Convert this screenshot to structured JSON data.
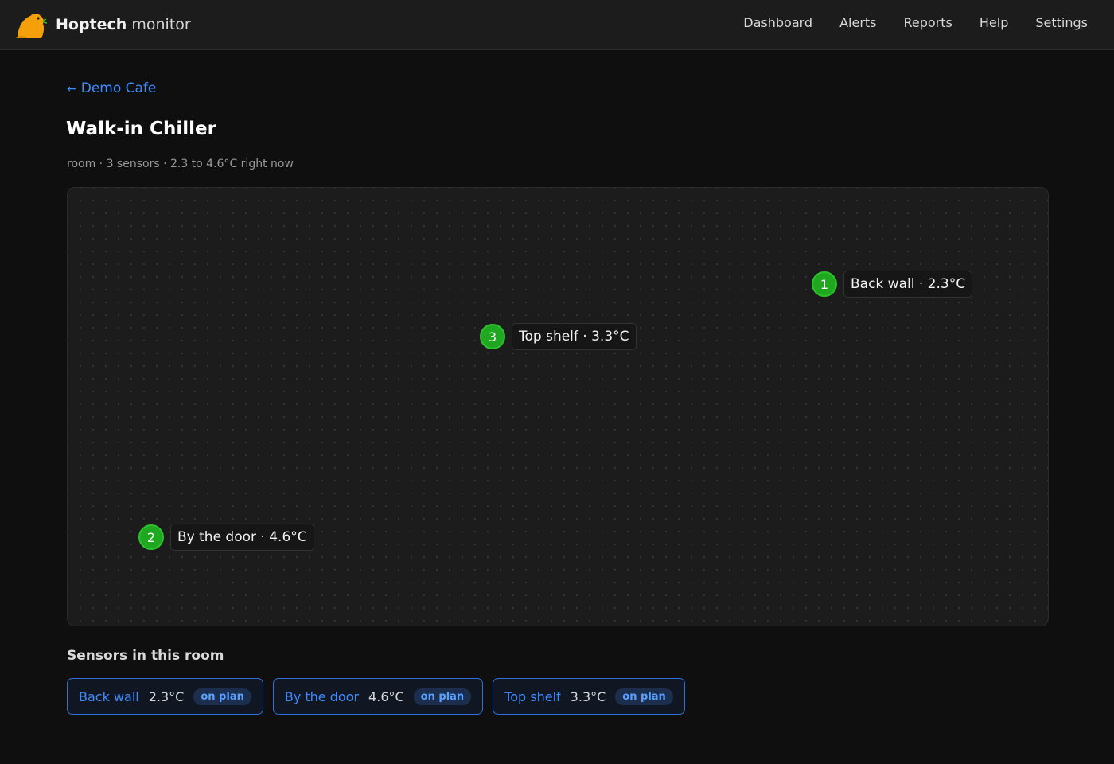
{
  "header": {
    "brand_bold": "Hoptech",
    "brand_light": "monitor",
    "logo_icon": "beaver-icon",
    "nav": [
      "Dashboard",
      "Alerts",
      "Reports",
      "Help",
      "Settings"
    ]
  },
  "breadcrumb": {
    "arrow": "←",
    "label": "Demo Cafe"
  },
  "page": {
    "title": "Walk-in Chiller",
    "subtitle": "room · 3 sensors · 2.3 to 4.6°C right now"
  },
  "plan": {
    "markers": [
      {
        "number": "1",
        "label": "Back wall · 2.3°C",
        "status_color": "#1fa81f"
      },
      {
        "number": "3",
        "label": "Top shelf · 3.3°C",
        "status_color": "#1fa81f"
      },
      {
        "number": "2",
        "label": "By the door · 4.6°C",
        "status_color": "#1fa81f"
      }
    ]
  },
  "sensors_section": {
    "title": "Sensors in this room",
    "chips": [
      {
        "name": "Back wall",
        "temp": "2.3°C",
        "badge": "on plan"
      },
      {
        "name": "By the door",
        "temp": "4.6°C",
        "badge": "on plan"
      },
      {
        "name": "Top shelf",
        "temp": "3.3°C",
        "badge": "on plan"
      }
    ]
  },
  "colors": {
    "accent": "#3d8bff",
    "ok_green": "#1fa81f",
    "brand_orange": "#f5a00a",
    "background": "#0f0f0f"
  }
}
